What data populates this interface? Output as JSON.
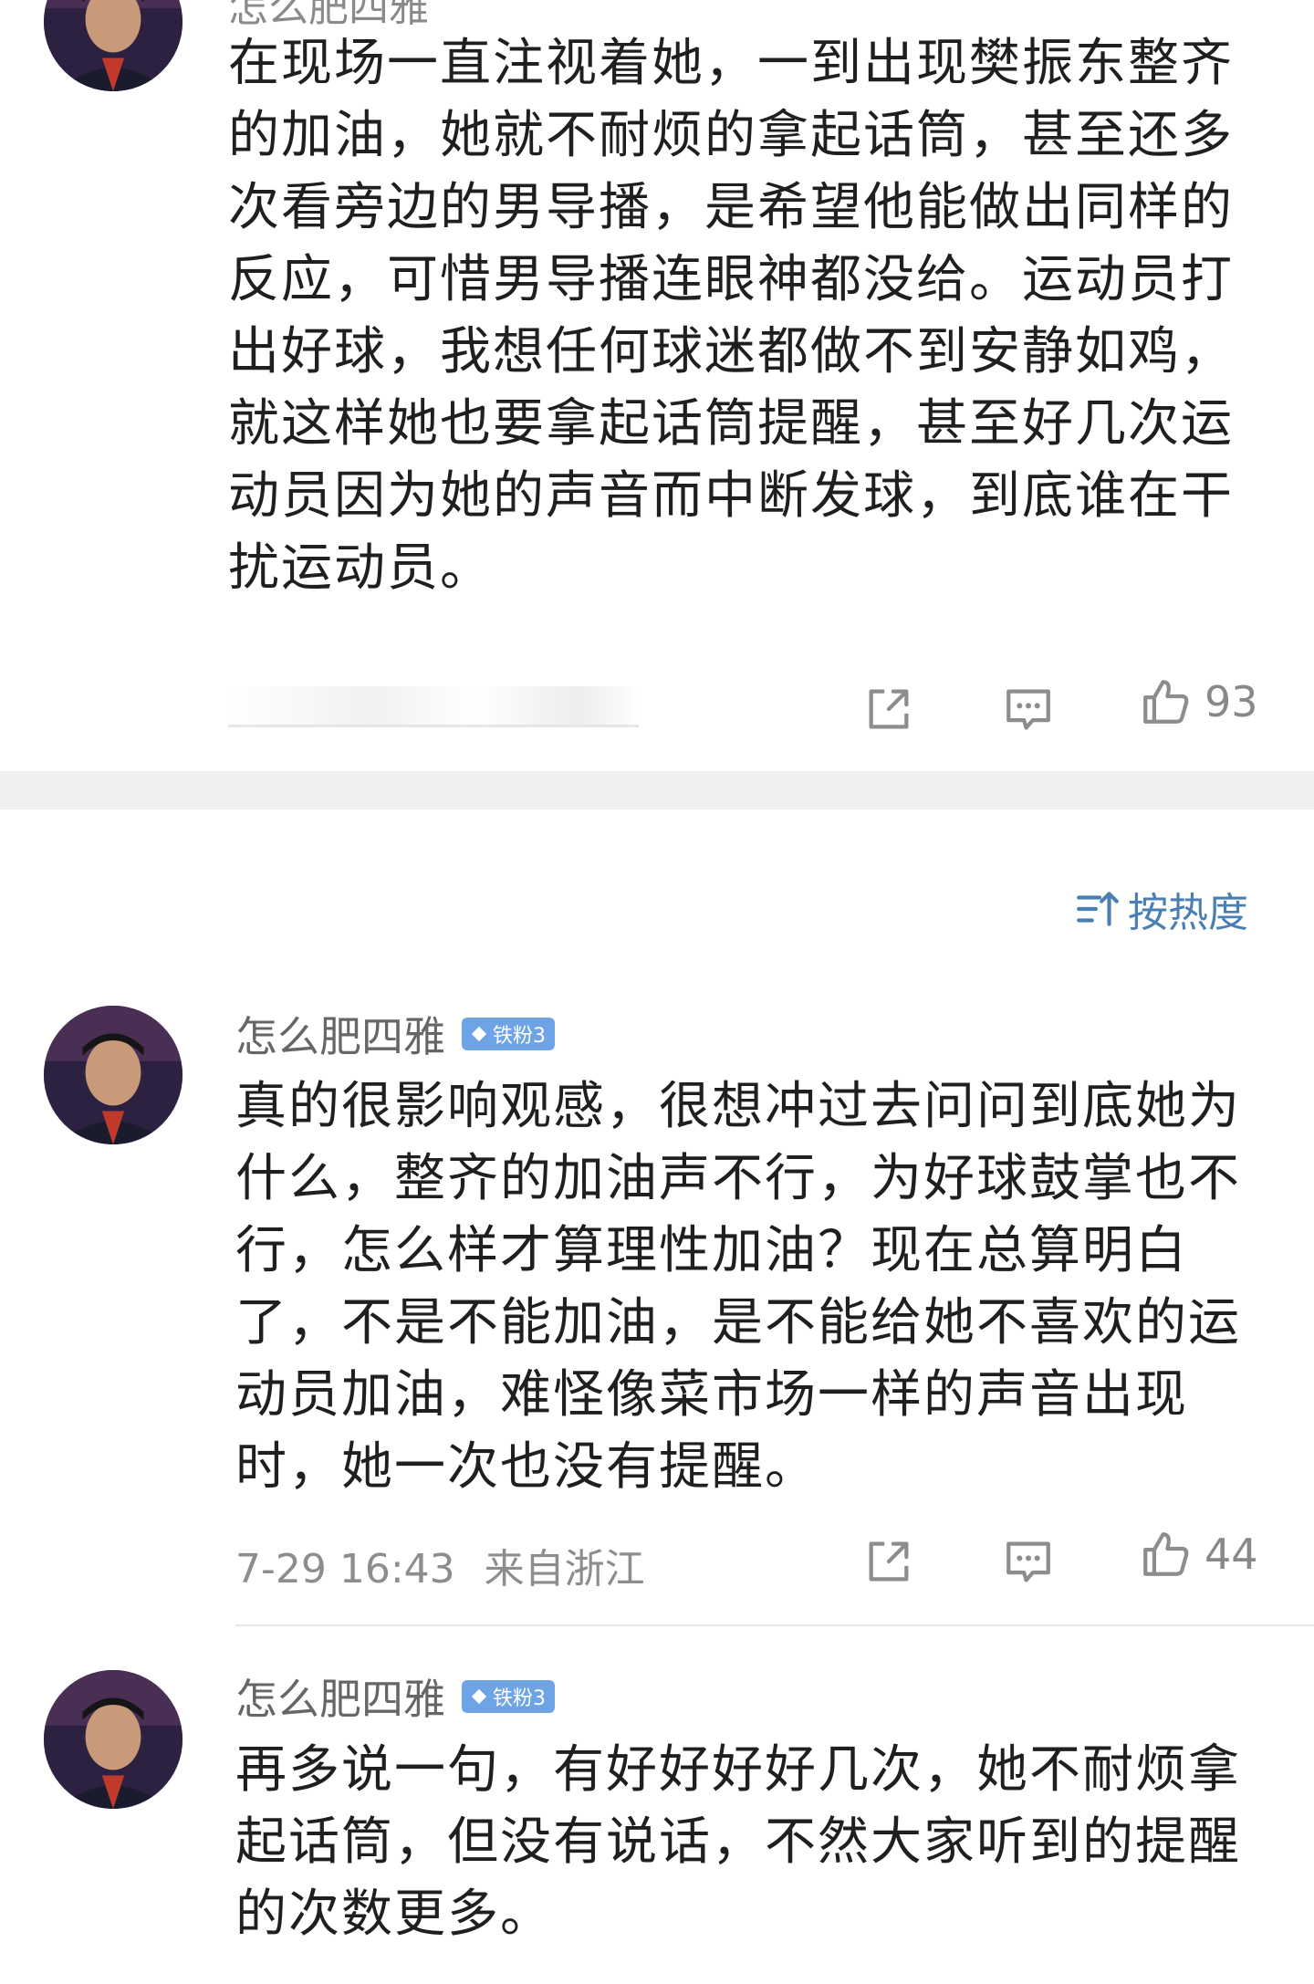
{
  "post": {
    "author_partial": "怎么肥四雅",
    "body": "在现场一直注视着她，一到出现樊振东整齐的加油，她就不耐烦的拿起话筒，甚至还多次看旁边的男导播，是希望他能做出同样的反应，可惜男导播连眼神都没给。运动员打出好球，我想任何球迷都做不到安静如鸡，就这样她也要拿起话筒提醒，甚至好几次运动员因为她的声音而中断发球，到底谁在干扰运动员。",
    "likes": "93"
  },
  "sort": {
    "label": "按热度",
    "icon": "sort-icon"
  },
  "comments": [
    {
      "name": "怎么肥四雅",
      "badge": "铁粉3",
      "body": "真的很影响观感，很想冲过去问问到底她为什么，整齐的加油声不行，为好球鼓掌也不行，怎么样才算理性加油？现在总算明白了，不是不能加油，是不能给她不喜欢的运动员加油，难怪像菜市场一样的声音出现时，她一次也没有提醒。",
      "time": "7-29 16:43",
      "location": "来自浙江",
      "likes": "44"
    },
    {
      "name": "怎么肥四雅",
      "badge": "铁粉3",
      "body": "再多说一句，有好好好好几次，她不耐烦拿起话筒，但没有说话，不然大家听到的提醒的次数更多。"
    }
  ],
  "colors": {
    "link": "#4a7fb3",
    "badge": "#6ea4e6",
    "meta": "#8d8d8d",
    "band": "#efefef"
  }
}
